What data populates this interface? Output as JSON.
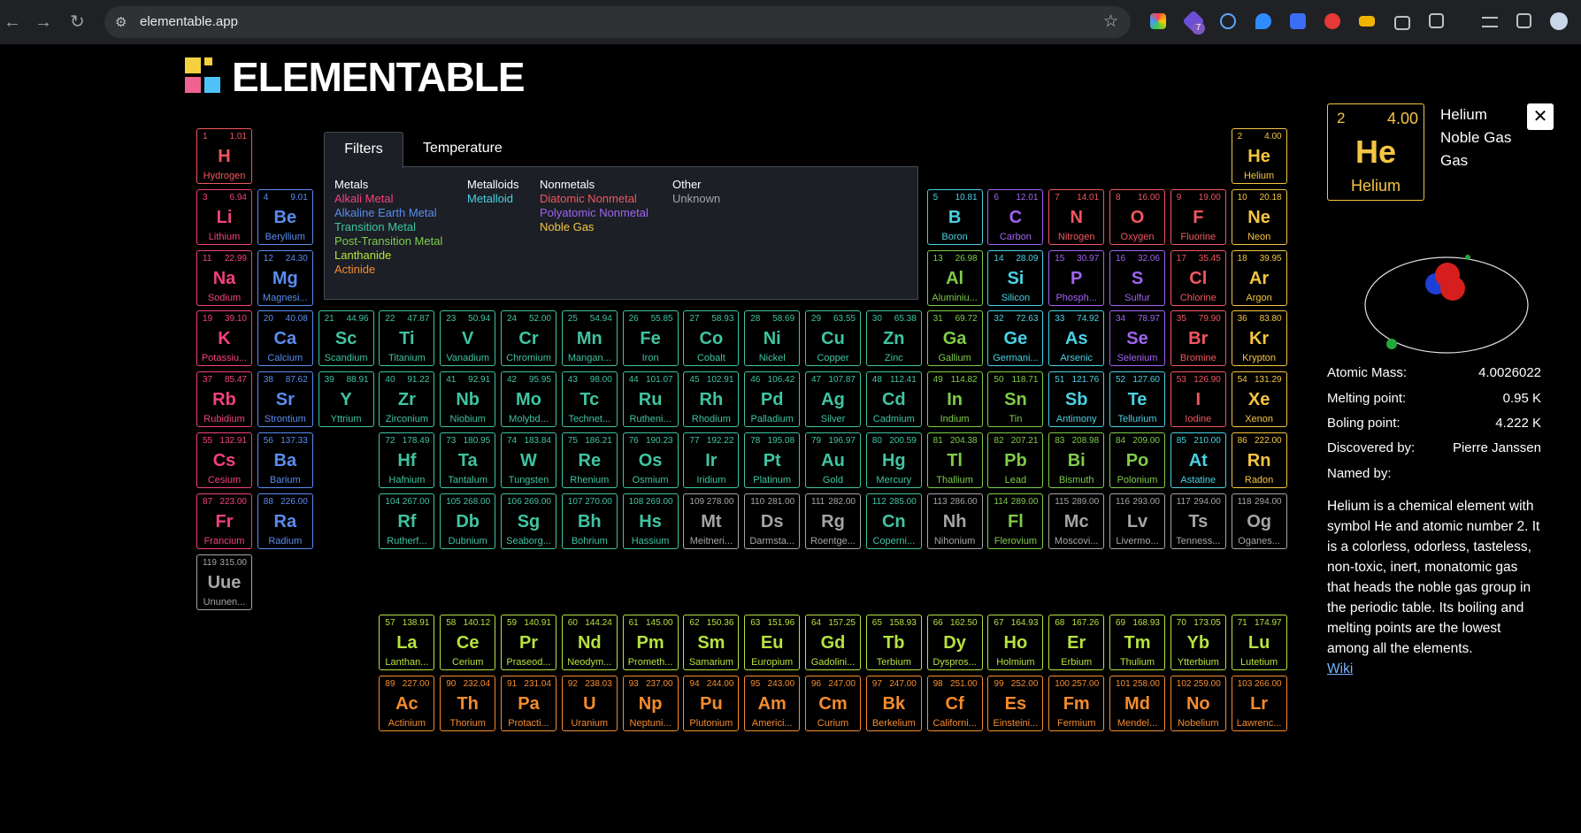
{
  "browser": {
    "url": "elementable.app",
    "tune_icon": "site-info-icon",
    "badge_count": "7"
  },
  "logo": {
    "text": "ELEMENTABLE"
  },
  "tabs": [
    {
      "label": "Filters"
    },
    {
      "label": "Temperature"
    }
  ],
  "filters": {
    "metals": {
      "heading": "Metals",
      "items": [
        "Alkali Metal",
        "Alkaline Earth Metal",
        "Transition Metal",
        "Post-Transition Metal",
        "Lanthanide",
        "Actinide"
      ]
    },
    "metalloids": {
      "heading": "Metalloids",
      "items": [
        "Metalloid"
      ]
    },
    "nonmetals": {
      "heading": "Nonmetals",
      "items": [
        "Diatomic Nonmetal",
        "Polyatomic Nonmetal",
        "Noble Gas"
      ]
    },
    "other": {
      "heading": "Other",
      "items": [
        "Unknown"
      ]
    }
  },
  "colors": {
    "alkali": "#f2427a",
    "alkaline": "#5b8cf0",
    "transition": "#3fc4a1",
    "post": "#7fcc4a",
    "metalloid": "#4ad1e3",
    "diatomic": "#f2565f",
    "polyatomic": "#a164f2",
    "noble": "#f5c542",
    "lanthanide": "#b6e33f",
    "actinide": "#f58b2e",
    "unknown": "#a5a5a5"
  },
  "elements": [
    [
      "1",
      "1.01",
      "H",
      "Hydrogen",
      "diatomic",
      1,
      1
    ],
    [
      "2",
      "4.00",
      "He",
      "Helium",
      "noble",
      18,
      1
    ],
    [
      "3",
      "6.94",
      "Li",
      "Lithium",
      "alkali",
      1,
      2
    ],
    [
      "4",
      "9.01",
      "Be",
      "Beryllium",
      "alkaline",
      2,
      2
    ],
    [
      "5",
      "10.81",
      "B",
      "Boron",
      "metalloid",
      13,
      2
    ],
    [
      "6",
      "12.01",
      "C",
      "Carbon",
      "polyatomic",
      14,
      2
    ],
    [
      "7",
      "14.01",
      "N",
      "Nitrogen",
      "diatomic",
      15,
      2
    ],
    [
      "8",
      "16.00",
      "O",
      "Oxygen",
      "diatomic",
      16,
      2
    ],
    [
      "9",
      "19.00",
      "F",
      "Fluorine",
      "diatomic",
      17,
      2
    ],
    [
      "10",
      "20.18",
      "Ne",
      "Neon",
      "noble",
      18,
      2
    ],
    [
      "11",
      "22.99",
      "Na",
      "Sodium",
      "alkali",
      1,
      3
    ],
    [
      "12",
      "24.30",
      "Mg",
      "Magnesi...",
      "alkaline",
      2,
      3
    ],
    [
      "13",
      "26.98",
      "Al",
      "Aluminiu...",
      "post",
      13,
      3
    ],
    [
      "14",
      "28.09",
      "Si",
      "Silicon",
      "metalloid",
      14,
      3
    ],
    [
      "15",
      "30.97",
      "P",
      "Phosph...",
      "polyatomic",
      15,
      3
    ],
    [
      "16",
      "32.06",
      "S",
      "Sulfur",
      "polyatomic",
      16,
      3
    ],
    [
      "17",
      "35.45",
      "Cl",
      "Chlorine",
      "diatomic",
      17,
      3
    ],
    [
      "18",
      "39.95",
      "Ar",
      "Argon",
      "noble",
      18,
      3
    ],
    [
      "19",
      "39.10",
      "K",
      "Potassiu...",
      "alkali",
      1,
      4
    ],
    [
      "20",
      "40.08",
      "Ca",
      "Calcium",
      "alkaline",
      2,
      4
    ],
    [
      "21",
      "44.96",
      "Sc",
      "Scandium",
      "transition",
      3,
      4
    ],
    [
      "22",
      "47.87",
      "Ti",
      "Titanium",
      "transition",
      4,
      4
    ],
    [
      "23",
      "50.94",
      "V",
      "Vanadium",
      "transition",
      5,
      4
    ],
    [
      "24",
      "52.00",
      "Cr",
      "Chromium",
      "transition",
      6,
      4
    ],
    [
      "25",
      "54.94",
      "Mn",
      "Mangan...",
      "transition",
      7,
      4
    ],
    [
      "26",
      "55.85",
      "Fe",
      "Iron",
      "transition",
      8,
      4
    ],
    [
      "27",
      "58.93",
      "Co",
      "Cobalt",
      "transition",
      9,
      4
    ],
    [
      "28",
      "58.69",
      "Ni",
      "Nickel",
      "transition",
      10,
      4
    ],
    [
      "29",
      "63.55",
      "Cu",
      "Copper",
      "transition",
      11,
      4
    ],
    [
      "30",
      "65.38",
      "Zn",
      "Zinc",
      "transition",
      12,
      4
    ],
    [
      "31",
      "69.72",
      "Ga",
      "Gallium",
      "post",
      13,
      4
    ],
    [
      "32",
      "72.63",
      "Ge",
      "Germani...",
      "metalloid",
      14,
      4
    ],
    [
      "33",
      "74.92",
      "As",
      "Arsenic",
      "metalloid",
      15,
      4
    ],
    [
      "34",
      "78.97",
      "Se",
      "Selenium",
      "polyatomic",
      16,
      4
    ],
    [
      "35",
      "79.90",
      "Br",
      "Bromine",
      "diatomic",
      17,
      4
    ],
    [
      "36",
      "83.80",
      "Kr",
      "Krypton",
      "noble",
      18,
      4
    ],
    [
      "37",
      "85.47",
      "Rb",
      "Rubidium",
      "alkali",
      1,
      5
    ],
    [
      "38",
      "87.62",
      "Sr",
      "Strontium",
      "alkaline",
      2,
      5
    ],
    [
      "39",
      "88.91",
      "Y",
      "Yttrium",
      "transition",
      3,
      5
    ],
    [
      "40",
      "91.22",
      "Zr",
      "Zirconium",
      "transition",
      4,
      5
    ],
    [
      "41",
      "92.91",
      "Nb",
      "Niobium",
      "transition",
      5,
      5
    ],
    [
      "42",
      "95.95",
      "Mo",
      "Molybd...",
      "transition",
      6,
      5
    ],
    [
      "43",
      "98.00",
      "Tc",
      "Technet...",
      "transition",
      7,
      5
    ],
    [
      "44",
      "101.07",
      "Ru",
      "Rutheni...",
      "transition",
      8,
      5
    ],
    [
      "45",
      "102.91",
      "Rh",
      "Rhodium",
      "transition",
      9,
      5
    ],
    [
      "46",
      "106.42",
      "Pd",
      "Palladium",
      "transition",
      10,
      5
    ],
    [
      "47",
      "107.87",
      "Ag",
      "Silver",
      "transition",
      11,
      5
    ],
    [
      "48",
      "112.41",
      "Cd",
      "Cadmium",
      "transition",
      12,
      5
    ],
    [
      "49",
      "114.82",
      "In",
      "Indium",
      "post",
      13,
      5
    ],
    [
      "50",
      "118.71",
      "Sn",
      "Tin",
      "post",
      14,
      5
    ],
    [
      "51",
      "121.76",
      "Sb",
      "Antimony",
      "metalloid",
      15,
      5
    ],
    [
      "52",
      "127.60",
      "Te",
      "Tellurium",
      "metalloid",
      16,
      5
    ],
    [
      "53",
      "126.90",
      "I",
      "Iodine",
      "diatomic",
      17,
      5
    ],
    [
      "54",
      "131.29",
      "Xe",
      "Xenon",
      "noble",
      18,
      5
    ],
    [
      "55",
      "132.91",
      "Cs",
      "Cesium",
      "alkali",
      1,
      6
    ],
    [
      "56",
      "137.33",
      "Ba",
      "Barium",
      "alkaline",
      2,
      6
    ],
    [
      "72",
      "178.49",
      "Hf",
      "Hafnium",
      "transition",
      4,
      6
    ],
    [
      "73",
      "180.95",
      "Ta",
      "Tantalum",
      "transition",
      5,
      6
    ],
    [
      "74",
      "183.84",
      "W",
      "Tungsten",
      "transition",
      6,
      6
    ],
    [
      "75",
      "186.21",
      "Re",
      "Rhenium",
      "transition",
      7,
      6
    ],
    [
      "76",
      "190.23",
      "Os",
      "Osmium",
      "transition",
      8,
      6
    ],
    [
      "77",
      "192.22",
      "Ir",
      "Iridium",
      "transition",
      9,
      6
    ],
    [
      "78",
      "195.08",
      "Pt",
      "Platinum",
      "transition",
      10,
      6
    ],
    [
      "79",
      "196.97",
      "Au",
      "Gold",
      "transition",
      11,
      6
    ],
    [
      "80",
      "200.59",
      "Hg",
      "Mercury",
      "transition",
      12,
      6
    ],
    [
      "81",
      "204.38",
      "Tl",
      "Thallium",
      "post",
      13,
      6
    ],
    [
      "82",
      "207.21",
      "Pb",
      "Lead",
      "post",
      14,
      6
    ],
    [
      "83",
      "208.98",
      "Bi",
      "Bismuth",
      "post",
      15,
      6
    ],
    [
      "84",
      "209.00",
      "Po",
      "Polonium",
      "post",
      16,
      6
    ],
    [
      "85",
      "210.00",
      "At",
      "Astatine",
      "metalloid",
      17,
      6
    ],
    [
      "86",
      "222.00",
      "Rn",
      "Radon",
      "noble",
      18,
      6
    ],
    [
      "87",
      "223.00",
      "Fr",
      "Francium",
      "alkali",
      1,
      7
    ],
    [
      "88",
      "226.00",
      "Ra",
      "Radium",
      "alkaline",
      2,
      7
    ],
    [
      "104",
      "267.00",
      "Rf",
      "Rutherf...",
      "transition",
      4,
      7
    ],
    [
      "105",
      "268.00",
      "Db",
      "Dubnium",
      "transition",
      5,
      7
    ],
    [
      "106",
      "269.00",
      "Sg",
      "Seaborg...",
      "transition",
      6,
      7
    ],
    [
      "107",
      "270.00",
      "Bh",
      "Bohrium",
      "transition",
      7,
      7
    ],
    [
      "108",
      "269.00",
      "Hs",
      "Hassium",
      "transition",
      8,
      7
    ],
    [
      "109",
      "278.00",
      "Mt",
      "Meitneri...",
      "unknown",
      9,
      7
    ],
    [
      "110",
      "281.00",
      "Ds",
      "Darmsta...",
      "unknown",
      10,
      7
    ],
    [
      "111",
      "282.00",
      "Rg",
      "Roentge...",
      "unknown",
      11,
      7
    ],
    [
      "112",
      "285.00",
      "Cn",
      "Coperni...",
      "transition",
      12,
      7
    ],
    [
      "113",
      "286.00",
      "Nh",
      "Nihonium",
      "unknown",
      13,
      7
    ],
    [
      "114",
      "289.00",
      "Fl",
      "Flerovium",
      "post",
      14,
      7
    ],
    [
      "115",
      "289.00",
      "Mc",
      "Moscovi...",
      "unknown",
      15,
      7
    ],
    [
      "116",
      "293.00",
      "Lv",
      "Livermo...",
      "unknown",
      16,
      7
    ],
    [
      "117",
      "294.00",
      "Ts",
      "Tenness...",
      "unknown",
      17,
      7
    ],
    [
      "118",
      "294.00",
      "Og",
      "Oganes...",
      "unknown",
      18,
      7
    ],
    [
      "119",
      "315.00",
      "Uue",
      "Ununen...",
      "unknown",
      1,
      8
    ],
    [
      "57",
      "138.91",
      "La",
      "Lanthan...",
      "lanthanide",
      4,
      9
    ],
    [
      "58",
      "140.12",
      "Ce",
      "Cerium",
      "lanthanide",
      5,
      9
    ],
    [
      "59",
      "140.91",
      "Pr",
      "Praseod...",
      "lanthanide",
      6,
      9
    ],
    [
      "60",
      "144.24",
      "Nd",
      "Neodym...",
      "lanthanide",
      7,
      9
    ],
    [
      "61",
      "145.00",
      "Pm",
      "Prometh...",
      "lanthanide",
      8,
      9
    ],
    [
      "62",
      "150.36",
      "Sm",
      "Samarium",
      "lanthanide",
      9,
      9
    ],
    [
      "63",
      "151.96",
      "Eu",
      "Europium",
      "lanthanide",
      10,
      9
    ],
    [
      "64",
      "157.25",
      "Gd",
      "Gadolini...",
      "lanthanide",
      11,
      9
    ],
    [
      "65",
      "158.93",
      "Tb",
      "Terbium",
      "lanthanide",
      12,
      9
    ],
    [
      "66",
      "162.50",
      "Dy",
      "Dyspros...",
      "lanthanide",
      13,
      9
    ],
    [
      "67",
      "164.93",
      "Ho",
      "Holmium",
      "lanthanide",
      14,
      9
    ],
    [
      "68",
      "167.26",
      "Er",
      "Erbium",
      "lanthanide",
      15,
      9
    ],
    [
      "69",
      "168.93",
      "Tm",
      "Thulium",
      "lanthanide",
      16,
      9
    ],
    [
      "70",
      "173.05",
      "Yb",
      "Ytterbium",
      "lanthanide",
      17,
      9
    ],
    [
      "71",
      "174.97",
      "Lu",
      "Lutetium",
      "lanthanide",
      18,
      9
    ],
    [
      "89",
      "227.00",
      "Ac",
      "Actinium",
      "actinide",
      4,
      10
    ],
    [
      "90",
      "232.04",
      "Th",
      "Thorium",
      "actinide",
      5,
      10
    ],
    [
      "91",
      "231.04",
      "Pa",
      "Protacti...",
      "actinide",
      6,
      10
    ],
    [
      "92",
      "238.03",
      "U",
      "Uranium",
      "actinide",
      7,
      10
    ],
    [
      "93",
      "237.00",
      "Np",
      "Neptuni...",
      "actinide",
      8,
      10
    ],
    [
      "94",
      "244.00",
      "Pu",
      "Plutonium",
      "actinide",
      9,
      10
    ],
    [
      "95",
      "243.00",
      "Am",
      "Americi...",
      "actinide",
      10,
      10
    ],
    [
      "96",
      "247.00",
      "Cm",
      "Curium",
      "actinide",
      11,
      10
    ],
    [
      "97",
      "247.00",
      "Bk",
      "Berkelium",
      "actinide",
      12,
      10
    ],
    [
      "98",
      "251.00",
      "Cf",
      "Californi...",
      "actinide",
      13,
      10
    ],
    [
      "99",
      "252.00",
      "Es",
      "Einsteini...",
      "actinide",
      14,
      10
    ],
    [
      "100",
      "257.00",
      "Fm",
      "Fermium",
      "actinide",
      15,
      10
    ],
    [
      "101",
      "258.00",
      "Md",
      "Mendel...",
      "actinide",
      16,
      10
    ],
    [
      "102",
      "259.00",
      "No",
      "Nobelium",
      "actinide",
      17,
      10
    ],
    [
      "103",
      "266.00",
      "Lr",
      "Lawrenc...",
      "actinide",
      18,
      10
    ]
  ],
  "selected": {
    "number": "2",
    "mass": "4.00",
    "symbol": "He",
    "name": "Helium",
    "title": "Helium",
    "category": "Noble Gas",
    "phase": "Gas",
    "props": [
      {
        "k": "Atomic Mass:",
        "v": "4.0026022"
      },
      {
        "k": "Melting point:",
        "v": "0.95 K"
      },
      {
        "k": "Boling point:",
        "v": "4.222 K"
      },
      {
        "k": "Discovered by:",
        "v": "Pierre Janssen"
      },
      {
        "k": "Named by:",
        "v": ""
      }
    ],
    "description": "Helium is a chemical element with symbol He and atomic number 2. It is a colorless, odorless, tasteless, non-toxic, inert, monatomic gas that heads the noble gas group in the periodic table. Its boiling and melting points are the lowest among all the elements.",
    "wiki_label": "Wiki",
    "close_label": "✕"
  }
}
